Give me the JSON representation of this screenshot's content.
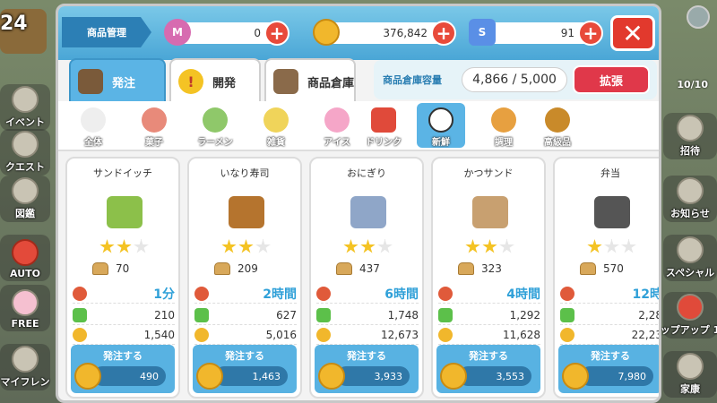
{
  "background": {
    "level": "24",
    "side_buttons": [
      {
        "label": "イベント"
      },
      {
        "label": "クエスト"
      },
      {
        "label": "図鑑"
      },
      {
        "label": "AUTO"
      },
      {
        "label": "FREE"
      },
      {
        "label": "マイフレン"
      }
    ],
    "right_counter": "10/10",
    "right_buttons": [
      {
        "label": "招待"
      },
      {
        "label": "お知らせ"
      },
      {
        "label": "スペシャル"
      },
      {
        "label": "ップアップ 1"
      },
      {
        "label": "家康"
      }
    ]
  },
  "header": {
    "title": "商品管理",
    "currencies": [
      {
        "icon": "medal-icon",
        "badge": "M",
        "value": "0",
        "color": "#d76bb0"
      },
      {
        "icon": "coin-icon",
        "badge": "",
        "value": "376,842",
        "color": "#f1b72c"
      },
      {
        "icon": "gem-icon",
        "badge": "S",
        "value": "91",
        "color": "#5a8fe6"
      }
    ],
    "close_label": "✕"
  },
  "tabs": [
    {
      "label": "発注",
      "active": true
    },
    {
      "label": "開発",
      "active": false
    },
    {
      "label": "商品倉庫",
      "active": false
    }
  ],
  "storage": {
    "label": "商品倉庫容量",
    "value": "4,866 / 5,000",
    "expand_label": "拡張"
  },
  "categories": [
    {
      "label": "全体",
      "active": false,
      "color": "#dddddd"
    },
    {
      "label": "菓子",
      "active": false,
      "color": "#e88a7a"
    },
    {
      "label": "ラーメン",
      "active": false,
      "color": "#8fc86a"
    },
    {
      "label": "雑貨",
      "active": false,
      "color": "#f0d45a"
    },
    {
      "label": "アイス",
      "active": false,
      "color": "#f5a6c8"
    },
    {
      "label": "ドリンク",
      "active": false,
      "color": "#e04a3a"
    },
    {
      "label": "新鮮",
      "active": true,
      "color": "#ffffff"
    },
    {
      "label": "調理",
      "active": false,
      "color": "#e7a040"
    },
    {
      "label": "高級品",
      "active": false,
      "color": "#c98a2a"
    }
  ],
  "products": [
    {
      "name": "サンドイッチ",
      "stars": 2,
      "bread": "70",
      "time": "1分",
      "exp": "210",
      "coins": "1,540",
      "order_label": "発注する",
      "cost": "490",
      "img_color": "#8cc04a"
    },
    {
      "name": "いなり寿司",
      "stars": 2,
      "bread": "209",
      "time": "2時間",
      "exp": "627",
      "coins": "5,016",
      "order_label": "発注する",
      "cost": "1,463",
      "img_color": "#b5742e"
    },
    {
      "name": "おにぎり",
      "stars": 2,
      "bread": "437",
      "time": "6時間",
      "exp": "1,748",
      "coins": "12,673",
      "order_label": "発注する",
      "cost": "3,933",
      "img_color": "#8fa6c8"
    },
    {
      "name": "かつサンド",
      "stars": 2,
      "bread": "323",
      "time": "4時間",
      "exp": "1,292",
      "coins": "11,628",
      "order_label": "発注する",
      "cost": "3,553",
      "img_color": "#c8a070"
    },
    {
      "name": "弁当",
      "stars": 1,
      "bread": "570",
      "time": "12時",
      "exp": "2,28",
      "coins": "22,23",
      "order_label": "発注する",
      "cost": "7,980",
      "img_color": "#555555"
    }
  ]
}
